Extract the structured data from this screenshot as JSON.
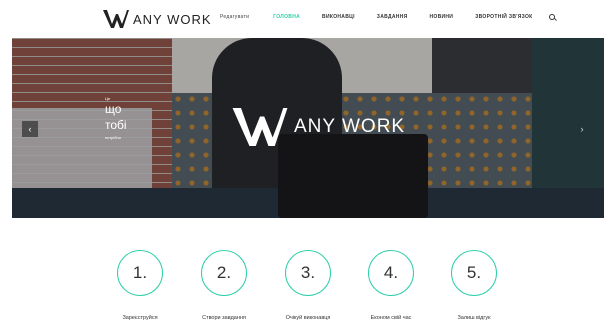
{
  "brand": {
    "name": "ANY WORK"
  },
  "nav": {
    "items": [
      {
        "label": "Редагувати"
      },
      {
        "label": "Головна"
      },
      {
        "label": "Виконавці"
      },
      {
        "label": "Завдання"
      },
      {
        "label": "Новини"
      },
      {
        "label": "Зворотній зв'язок"
      }
    ],
    "active_color": "#2ecfa9",
    "search_icon": "search-icon"
  },
  "hero": {
    "tagline_top": "Це",
    "tagline_main": [
      "що",
      "тобі"
    ],
    "tagline_bottom": "потрібно",
    "brand": "ANY WORK",
    "prev_icon": "‹",
    "next_icon": "›"
  },
  "steps": [
    {
      "number": "1.",
      "label": "Зареєструйся"
    },
    {
      "number": "2.",
      "label": "Створи завдання"
    },
    {
      "number": "3.",
      "label": "Очікуй виконавця"
    },
    {
      "number": "4.",
      "label": "Економ свій час"
    },
    {
      "number": "5.",
      "label": "Залиш відгук"
    }
  ],
  "colors": {
    "accent": "#2ecfa9"
  }
}
